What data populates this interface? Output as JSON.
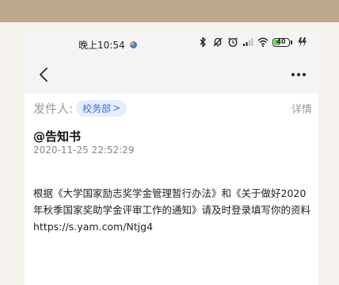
{
  "status_bar": {
    "time": "晚上10:54",
    "battery_level": "40",
    "icons": [
      "bluetooth-icon",
      "mute-icon",
      "alarm-icon",
      "signal-icon",
      "wifi-icon",
      "battery-icon",
      "charging-icon"
    ]
  },
  "nav": {
    "back_icon": "chevron-left-icon",
    "more_icon": "more-dots-icon"
  },
  "message": {
    "sender_label": "发件人:",
    "sender_name": "校务部",
    "sender_chevron": ">",
    "detail_label": "详情",
    "title": "@告知书",
    "date": "2020-11-25 22:52:29",
    "body": "根据《大学国家励志奖学金管理暂行办法》和《关于做好2020年秋季国家奖助学金评审工作的通知》请及时登录填写你的资料 https://s.yam.com/Ntjg4"
  },
  "colors": {
    "top_band": "#bba78b",
    "tag_bg": "#e6eefc",
    "tag_text": "#3b6fd4",
    "battery_fill": "#5ccd4a"
  }
}
